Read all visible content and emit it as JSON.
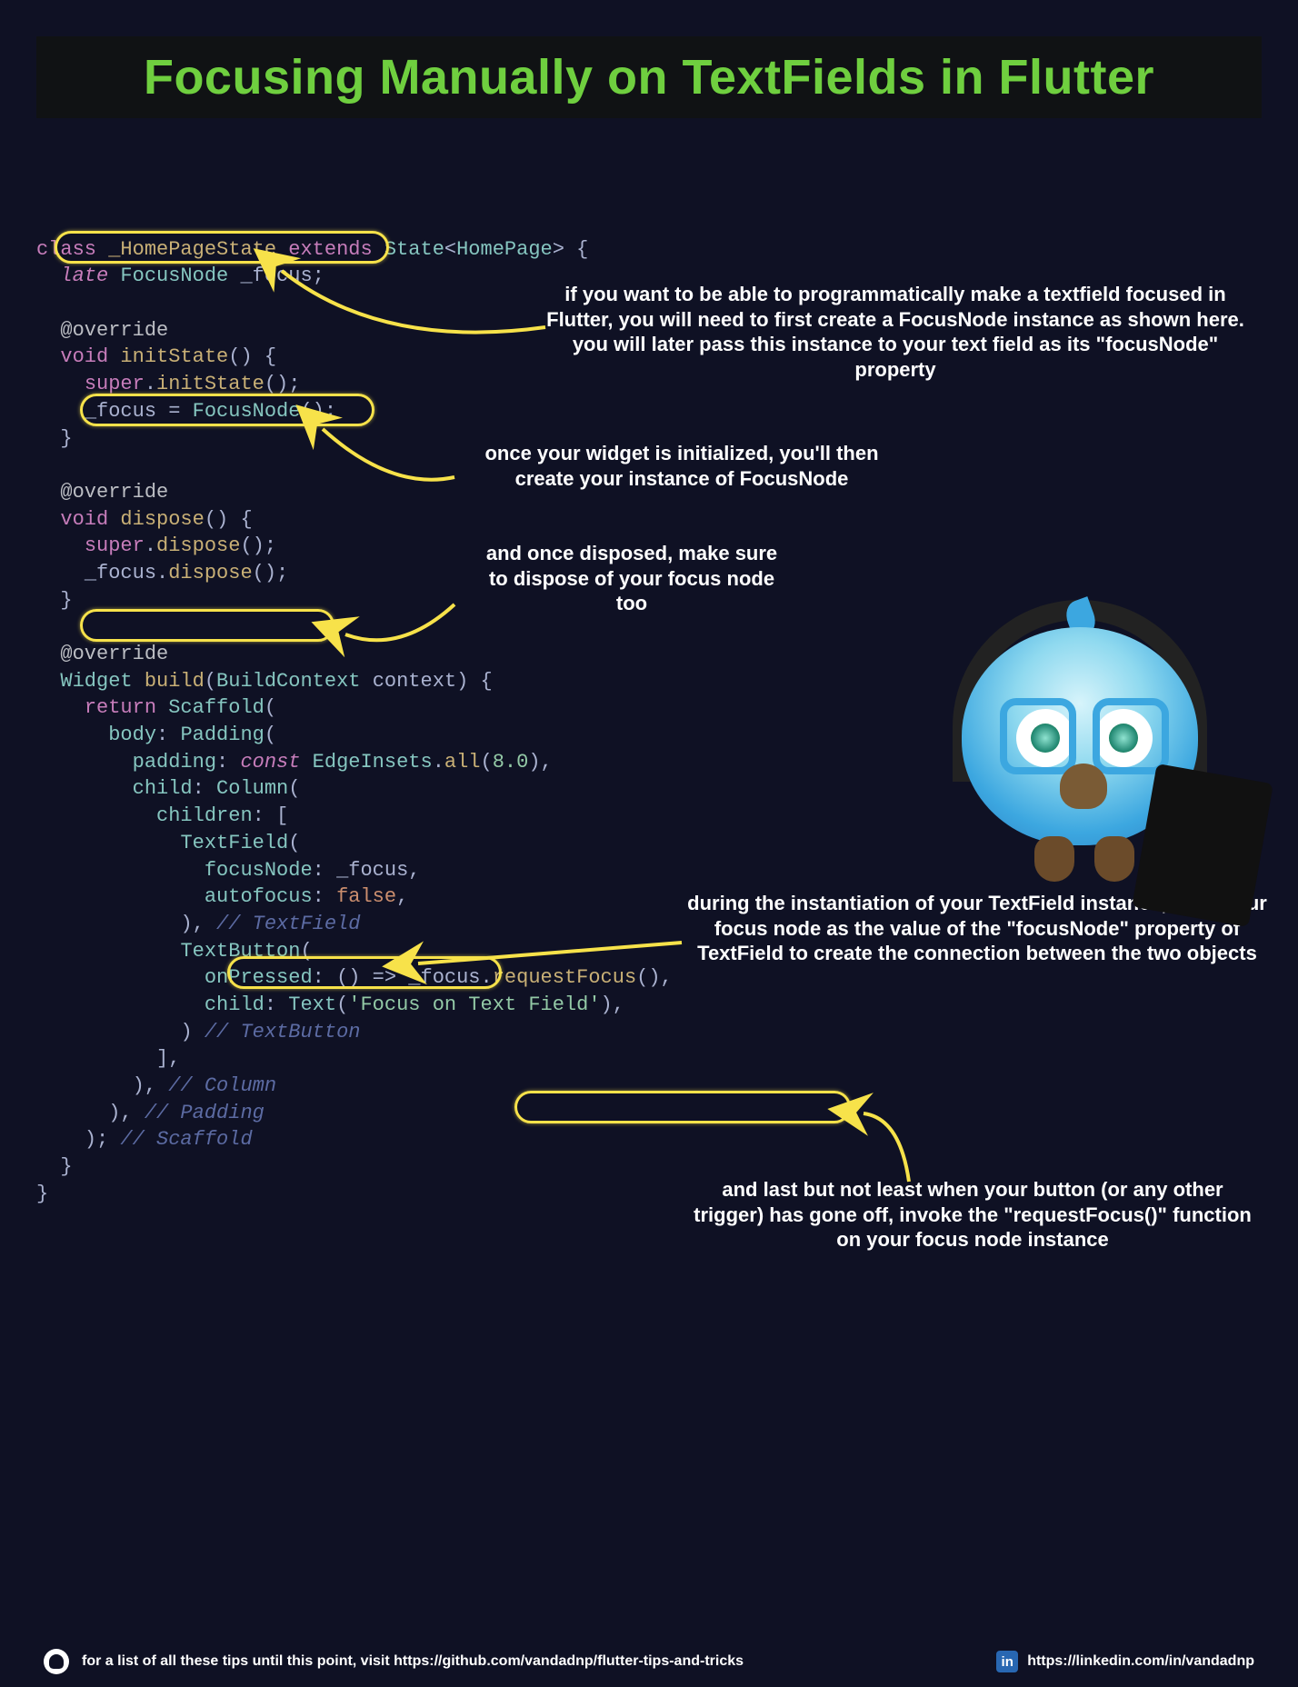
{
  "title": "Focusing Manually on TextFields in Flutter",
  "annotations": {
    "a1": "if you want to be able to programmatically make a textfield focused in Flutter, you will need to first create a FocusNode instance as shown here. you will later pass this instance to your text field as its \"focusNode\" property",
    "a2": "once your widget is initialized, you'll then create your instance of FocusNode",
    "a3": "and once disposed, make sure to dispose of your focus node too",
    "a4": "during the instantiation of your TextField instance, pass your focus node as the value of the \"focusNode\" property of TextField to create the connection between the two objects",
    "a5": "and last but not least when your button (or any other trigger) has gone off, invoke the \"requestFocus()\" function on your focus node instance"
  },
  "code": {
    "l01_class": "class",
    "l01_name": "_HomePageState",
    "l01_extends": "extends",
    "l01_state": "State",
    "l01_hp": "HomePage",
    "l02_late": "late",
    "l02_type": "FocusNode",
    "l02_var": "_focus",
    "l04_over": "@override",
    "l05_void": "void",
    "l05_init": "initState",
    "l06_super": "super",
    "l06_init": "initState",
    "l07_focus": "_focus",
    "l07_ctor": "FocusNode",
    "l10_over": "@override",
    "l11_void": "void",
    "l11_disp": "dispose",
    "l12_super": "super",
    "l12_disp": "dispose",
    "l13_focus": "_focus",
    "l13_disp": "dispose",
    "l16_over": "@override",
    "l17_widget": "Widget",
    "l17_build": "build",
    "l17_bc": "BuildContext",
    "l17_ctx": "context",
    "l18_return": "return",
    "l18_scaf": "Scaffold",
    "l19_body": "body",
    "l19_pad": "Padding",
    "l20_padding": "padding",
    "l20_const": "const",
    "l20_ei": "EdgeInsets",
    "l20_all": "all",
    "l20_num": "8.0",
    "l21_child": "child",
    "l21_col": "Column",
    "l22_children": "children",
    "l23_tf": "TextField",
    "l24_fn": "focusNode",
    "l24_focus": "_focus",
    "l25_auto": "autofocus",
    "l25_false": "false",
    "l26_cmt": "// TextField",
    "l27_tb": "TextButton",
    "l28_onp": "onPressed",
    "l28_focus": "_focus",
    "l28_req": "requestFocus",
    "l29_child": "child",
    "l29_text": "Text",
    "l29_str": "'Focus on Text Field'",
    "l30_cmt": "// TextButton",
    "l33_cmt": "// Column",
    "l34_cmt": "// Padding",
    "l35_cmt": "// Scaffold"
  },
  "footer": {
    "left": "for a list of all these tips until this point, visit https://github.com/vandadnp/flutter-tips-and-tricks",
    "right": "https://linkedin.com/in/vandadnp",
    "in": "in"
  }
}
